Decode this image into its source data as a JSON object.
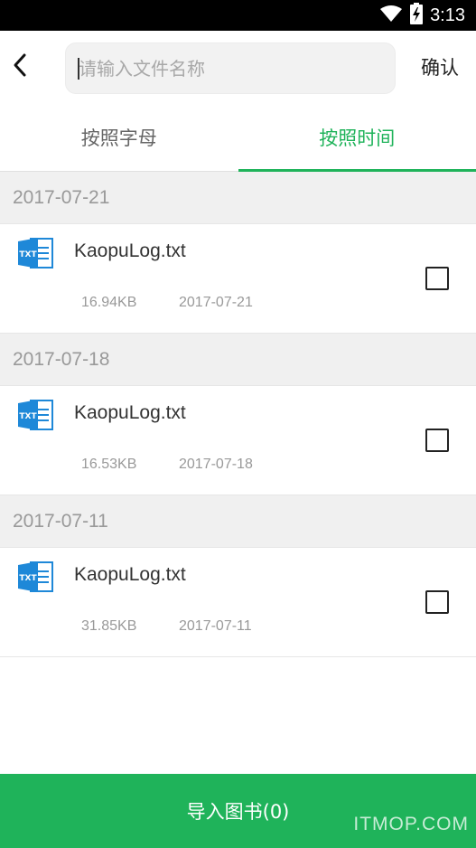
{
  "status_bar": {
    "time": "3:13",
    "icons": [
      "wifi-icon",
      "battery-charging-icon"
    ]
  },
  "search": {
    "placeholder": "请输入文件名称",
    "value": "",
    "confirm_label": "确认"
  },
  "tabs": [
    {
      "label": "按照字母",
      "active": false
    },
    {
      "label": "按照时间",
      "active": true
    }
  ],
  "groups": [
    {
      "date": "2017-07-21",
      "file": {
        "name": "KaopuLog.txt",
        "size": "16.94KB",
        "date": "2017-07-21",
        "checked": false,
        "icon_label": "TXT"
      }
    },
    {
      "date": "2017-07-18",
      "file": {
        "name": "KaopuLog.txt",
        "size": "16.53KB",
        "date": "2017-07-18",
        "checked": false,
        "icon_label": "TXT"
      }
    },
    {
      "date": "2017-07-11",
      "file": {
        "name": "KaopuLog.txt",
        "size": "31.85KB",
        "date": "2017-07-11",
        "checked": false,
        "icon_label": "TXT"
      }
    }
  ],
  "import_button": {
    "label": "导入图书(0)"
  },
  "watermark": "ITMOP.COM",
  "colors": {
    "accent": "#1fb35a",
    "section_bg": "#f0f0f0",
    "file_icon": "#1e88d8"
  }
}
